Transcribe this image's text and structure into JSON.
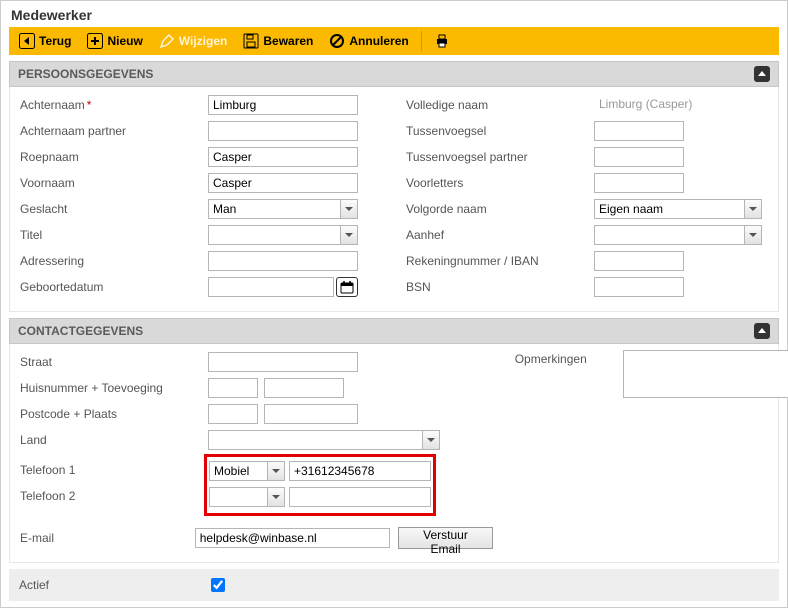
{
  "page_title": "Medewerker",
  "toolbar": {
    "back": "Terug",
    "new": "Nieuw",
    "edit": "Wijzigen",
    "save": "Bewaren",
    "cancel": "Annuleren"
  },
  "sections": {
    "personal": {
      "title": "PERSOONSGEGEVENS",
      "left": {
        "achternaam_label": "Achternaam",
        "achternaam_value": "Limburg",
        "achternaam_partner_label": "Achternaam partner",
        "achternaam_partner_value": "",
        "roepnaam_label": "Roepnaam",
        "roepnaam_value": "Casper",
        "voornaam_label": "Voornaam",
        "voornaam_value": "Casper",
        "geslacht_label": "Geslacht",
        "geslacht_value": "Man",
        "titel_label": "Titel",
        "titel_value": "",
        "adressering_label": "Adressering",
        "adressering_value": "",
        "geboortedatum_label": "Geboortedatum",
        "geboortedatum_value": ""
      },
      "right": {
        "volledige_naam_label": "Volledige naam",
        "volledige_naam_value": "Limburg (Casper)",
        "tussenvoegsel_label": "Tussenvoegsel",
        "tussenvoegsel_value": "",
        "tussenvoegsel_partner_label": "Tussenvoegsel partner",
        "tussenvoegsel_partner_value": "",
        "voorletters_label": "Voorletters",
        "voorletters_value": "",
        "volgorde_naam_label": "Volgorde naam",
        "volgorde_naam_value": "Eigen naam",
        "aanhef_label": "Aanhef",
        "aanhef_value": "",
        "rekening_label": "Rekeningnummer / IBAN",
        "rekening_value": "",
        "bsn_label": "BSN",
        "bsn_value": ""
      }
    },
    "contact": {
      "title": "CONTACTGEGEVENS",
      "straat_label": "Straat",
      "straat_value": "",
      "huisnr_label": "Huisnummer + Toevoeging",
      "huisnr_value": "",
      "huisnr_toevoeging_value": "",
      "postcode_label": "Postcode + Plaats",
      "postcode_value": "",
      "plaats_value": "",
      "land_label": "Land",
      "land_value": "",
      "telefoon1_label": "Telefoon 1",
      "telefoon1_type": "Mobiel",
      "telefoon1_value": "+31612345678",
      "telefoon2_label": "Telefoon 2",
      "telefoon2_type": "",
      "telefoon2_value": "",
      "opmerkingen_label": "Opmerkingen",
      "opmerkingen_value": "",
      "email_label": "E-mail",
      "email_value": "helpdesk@winbase.nl",
      "send_email_button": "Verstuur Email",
      "actief_label": "Actief",
      "actief_checked": true
    }
  }
}
